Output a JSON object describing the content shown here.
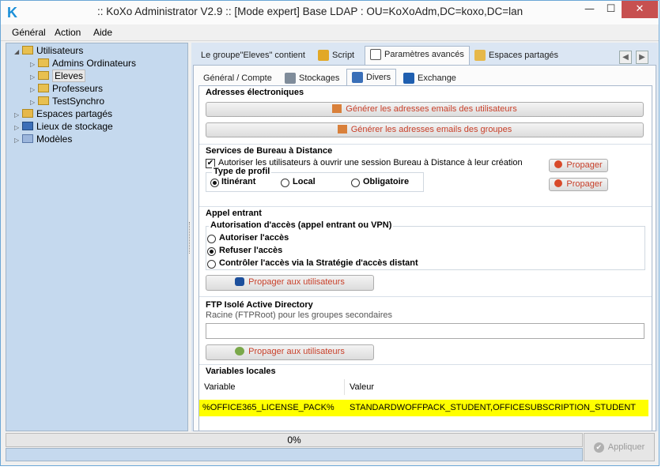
{
  "window": {
    "icon_letter": "K",
    "title": ":: KoXo Administrator V2.9 :: [Mode expert] Base LDAP : OU=KoXoAdm,DC=koxo,DC=lan",
    "min": "—",
    "max": "☐",
    "close": "✕"
  },
  "menu": [
    "Général",
    "Action",
    "Aide"
  ],
  "tree": {
    "items": [
      {
        "label": "Utilisateurs",
        "arrow": "◢"
      },
      {
        "label": "Admins Ordinateurs",
        "arrow": "▷"
      },
      {
        "label": "Eleves",
        "arrow": "▷",
        "selected": true
      },
      {
        "label": "Professeurs",
        "arrow": "▷"
      },
      {
        "label": "TestSynchro",
        "arrow": "▷"
      },
      {
        "label": "Espaces partagés",
        "arrow": "▷"
      },
      {
        "label": "Lieux de stockage",
        "arrow": "▷"
      },
      {
        "label": "Modèles",
        "arrow": "▷"
      }
    ]
  },
  "tabs_top": [
    "Le groupe\"Eleves\" contient",
    "Script",
    "Paramètres avancés",
    "Espaces partagés"
  ],
  "nav": {
    "prev": "◀",
    "next": "▶"
  },
  "tabs_sub": [
    "Général / Compte",
    "Stockages",
    "Divers",
    "Exchange"
  ],
  "email": {
    "title": "Adresses électroniques",
    "btn_users": "Générer les adresses emails des utilisateurs",
    "btn_groups": "Générer les adresses emails des groupes"
  },
  "rds": {
    "title": "Services de Bureau à Distance",
    "checkbox_label": "Autoriser les utilisateurs à ouvrir une session Bureau à Distance à leur création",
    "checkbox_mark": "✔",
    "profile_title": "Type de profil",
    "profiles": [
      "Itinérant",
      "Local",
      "Obligatoire"
    ],
    "selected_profile": "Itinérant",
    "propagate1": "Propager",
    "propagate2": "Propager"
  },
  "dialin": {
    "title": "Appel entrant",
    "group_title": "Autorisation d'accès (appel entrant ou VPN)",
    "options": [
      "Autoriser l'accès",
      "Refuser l'accès",
      "Contrôler l'accès via la Stratégie d'accès distant"
    ],
    "selected": "Refuser l'accès",
    "propagate": "Propager aux utilisateurs"
  },
  "ftp": {
    "title": "FTP Isolé Active Directory",
    "subtitle": "Racine (FTPRoot) pour les groupes secondaires",
    "value": "",
    "propagate": "Propager aux utilisateurs"
  },
  "vars": {
    "title": "Variables locales",
    "col_variable": "Variable",
    "col_value": "Valeur",
    "rows": [
      {
        "variable": "%OFFICE365_LICENSE_PACK%",
        "value": "STANDARDWOFFPACK_STUDENT,OFFICESUBSCRIPTION_STUDENT"
      }
    ]
  },
  "status": {
    "progress_text": "0%",
    "progress": 0,
    "apply_label": "Appliquer",
    "apply_icon": "✔"
  }
}
